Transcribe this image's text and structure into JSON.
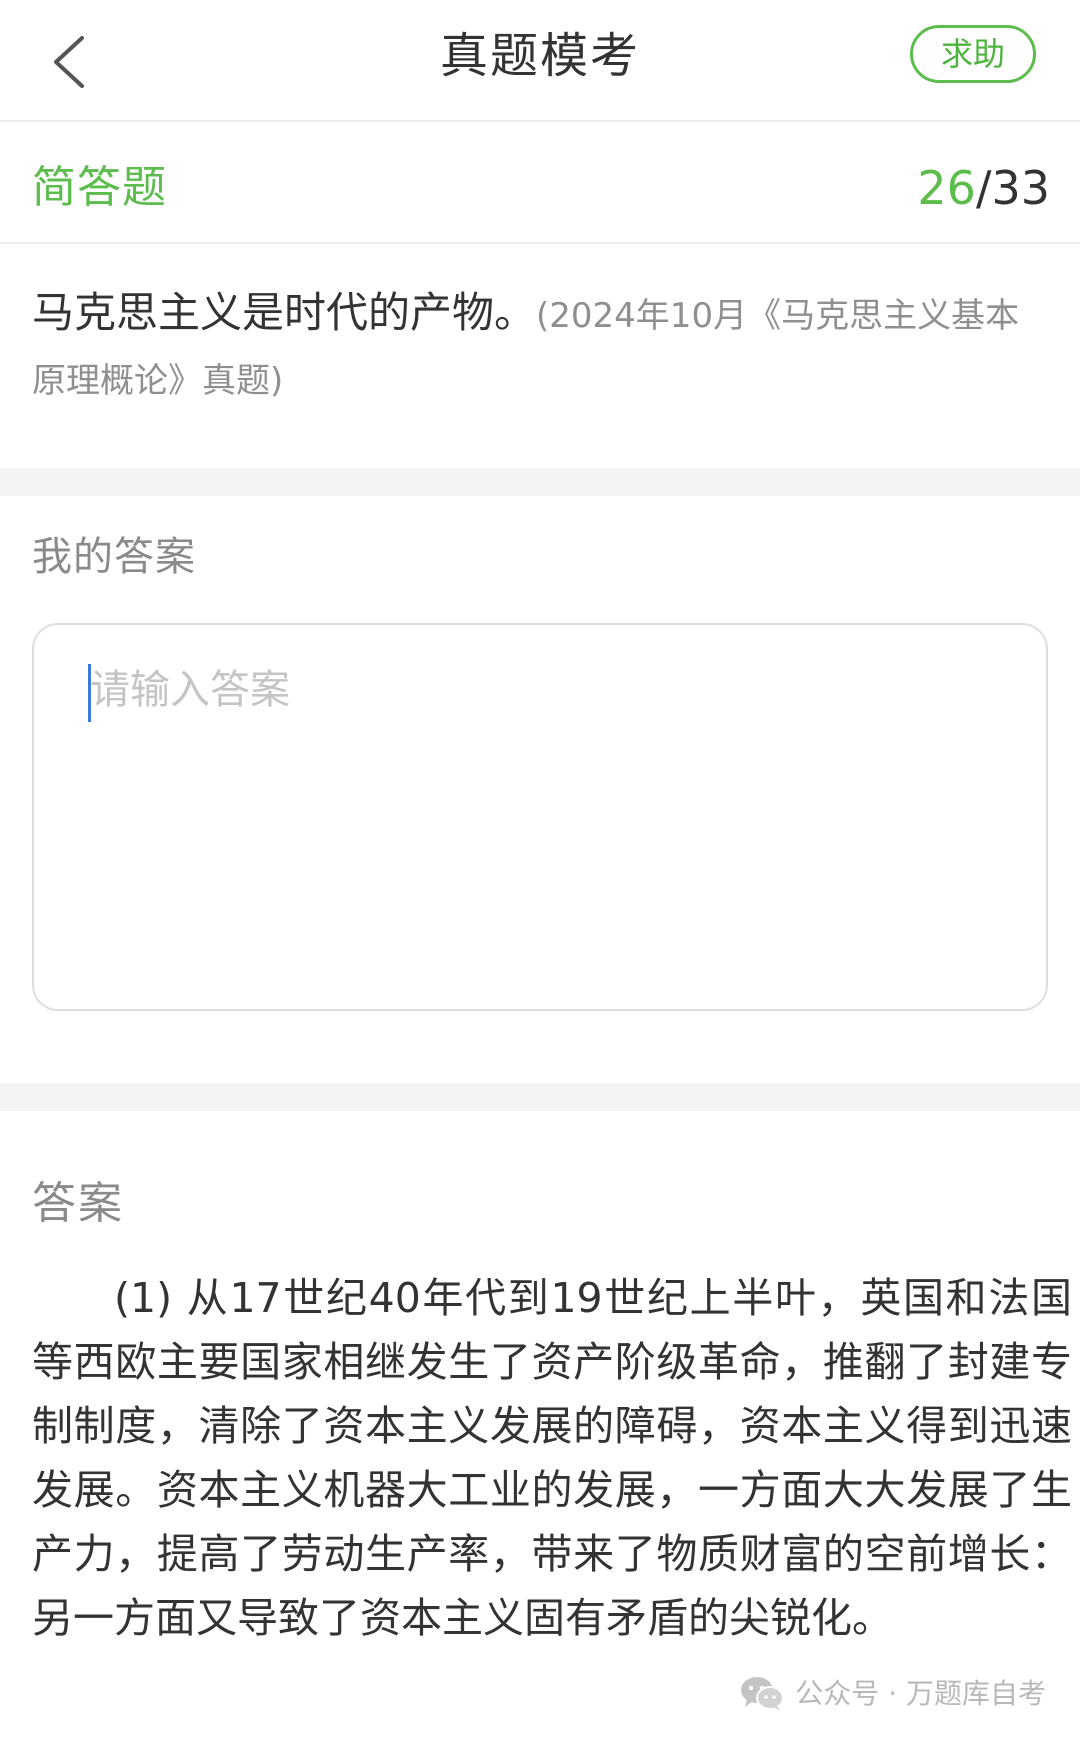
{
  "header": {
    "title": "真题模考",
    "help_label": "求助"
  },
  "question": {
    "type_label": "简答题",
    "current": "26",
    "separator": "/",
    "total": "33",
    "text": "马克思主义是时代的产物。",
    "source": "(2024年10月《马克思主义基本原理概论》真题)"
  },
  "my_answer": {
    "label": "我的答案",
    "placeholder": "请输入答案",
    "value": ""
  },
  "answer": {
    "label": "答案",
    "text": "(1) 从17世纪40年代到19世纪上半叶，英国和法国等西欧主要国家相继发生了资产阶级革命，推翻了封建专制制度，清除了资本主义发展的障碍，资本主义得到迅速发展。资本主义机器大工业的发展，一方面大大发展了生产力，提高了劳动生产率，带来了物质财富的空前增长：另一方面又导致了资本主义固有矛盾的尖锐化。"
  },
  "watermark": {
    "text": "公众号 · 万题库自考",
    "logo_icon": "wechat-logo-icon"
  },
  "colors": {
    "accent": "#5cbd4d",
    "text": "#333333",
    "muted": "#8a8a8a",
    "divider": "#ececec",
    "band": "#f4f4f4"
  }
}
